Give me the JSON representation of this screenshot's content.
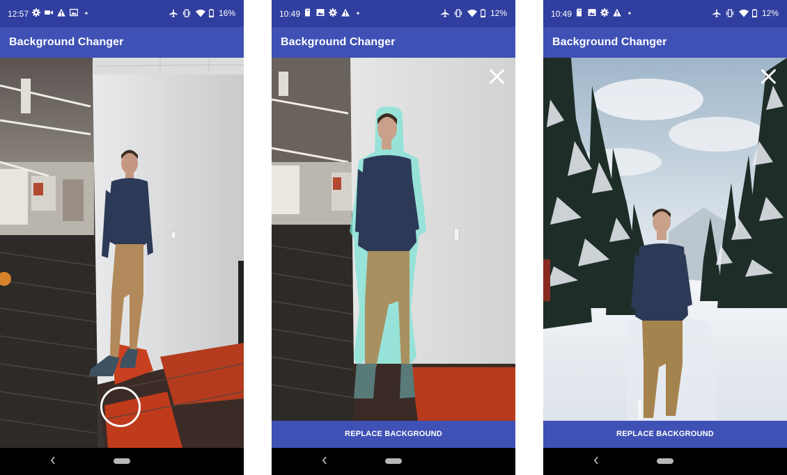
{
  "screens": [
    {
      "status_bar": {
        "time": "12:57",
        "battery": "16%",
        "left_icons": [
          "settings-icon",
          "video-camera-icon",
          "warning-icon",
          "gallery-icon",
          "dot-icon"
        ],
        "right_icons": [
          "airplane-icon",
          "vibrate-icon",
          "wifi-icon",
          "battery-icon"
        ]
      },
      "app_bar": {
        "title": "Background Changer"
      },
      "mode": "camera-preview",
      "shutter_button": "capture-icon"
    },
    {
      "status_bar": {
        "time": "10:49",
        "battery": "12%",
        "left_icons": [
          "sim-icon",
          "image-icon",
          "settings-icon",
          "warning-icon",
          "dot-icon"
        ],
        "right_icons": [
          "airplane-icon",
          "vibrate-icon",
          "wifi-icon",
          "battery-icon"
        ]
      },
      "app_bar": {
        "title": "Background Changer"
      },
      "mode": "segmentation-preview",
      "close_icon": "close-icon",
      "action_button": "REPLACE BACKGROUND"
    },
    {
      "status_bar": {
        "time": "10:49",
        "battery": "12%",
        "left_icons": [
          "sim-icon",
          "image-icon",
          "settings-icon",
          "warning-icon",
          "dot-icon"
        ],
        "right_icons": [
          "airplane-icon",
          "vibrate-icon",
          "wifi-icon",
          "battery-icon"
        ]
      },
      "app_bar": {
        "title": "Background Changer"
      },
      "mode": "replaced-background",
      "close_icon": "close-icon",
      "action_button": "REPLACE BACKGROUND"
    }
  ],
  "colors": {
    "status_bar": "#303f9f",
    "app_bar": "#3f51b5",
    "nav_bar": "#000000",
    "segment_glow": "#7fe3d6"
  }
}
